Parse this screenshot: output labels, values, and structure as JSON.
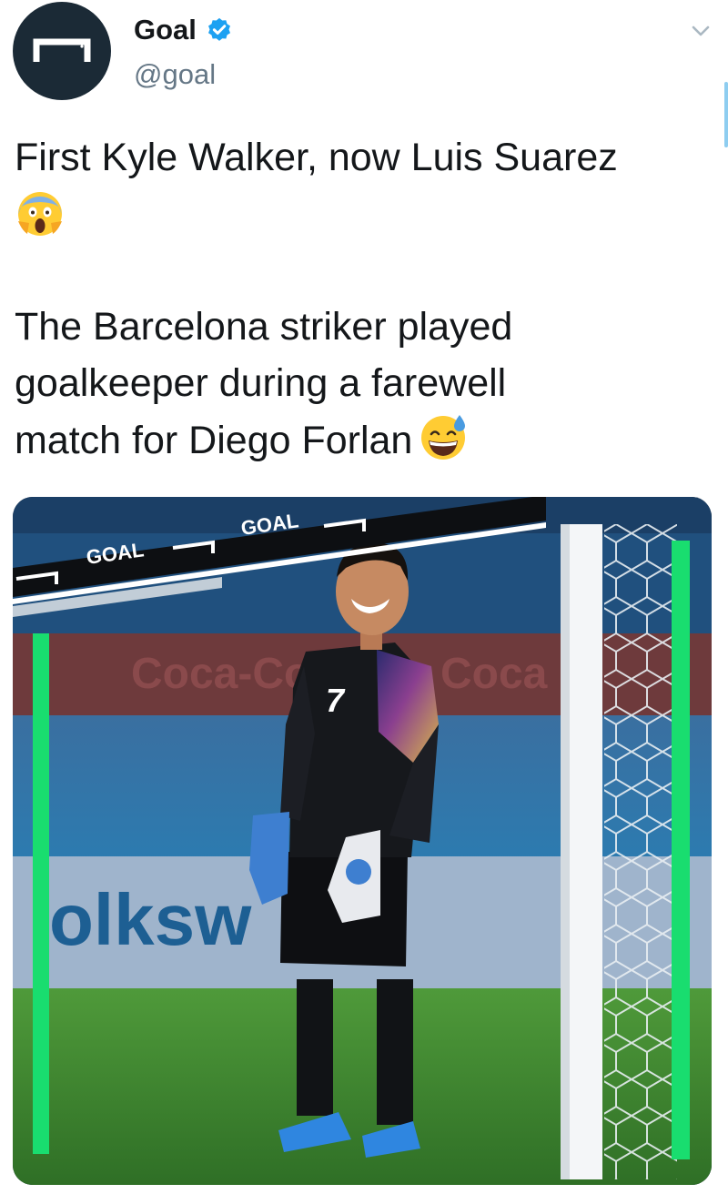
{
  "account": {
    "display_name": "Goal",
    "handle": "@goal",
    "verified": true,
    "avatar_icon": "goal-logo-icon",
    "verified_icon": "verified-badge-icon",
    "menu_icon": "chevron-down-icon"
  },
  "tweet": {
    "line1": "First Kyle Walker, now Luis Suarez",
    "emoji1": "screaming-in-fear-emoji",
    "line2": "The Barcelona striker played",
    "line3": "goalkeeper during a farewell",
    "line4": "match for Diego Forlan",
    "emoji2": "grinning-face-with-sweat-emoji"
  },
  "media": {
    "overlay_brand_1": "GOAL",
    "overlay_brand_2": "GOAL",
    "banner_text": "olksw   en",
    "jersey_number": "7"
  },
  "colors": {
    "accent_blue": "#1da1f2",
    "muted_text": "#657786",
    "avatar_bg": "#1b2a36",
    "frame_green": "#19dd6f"
  }
}
